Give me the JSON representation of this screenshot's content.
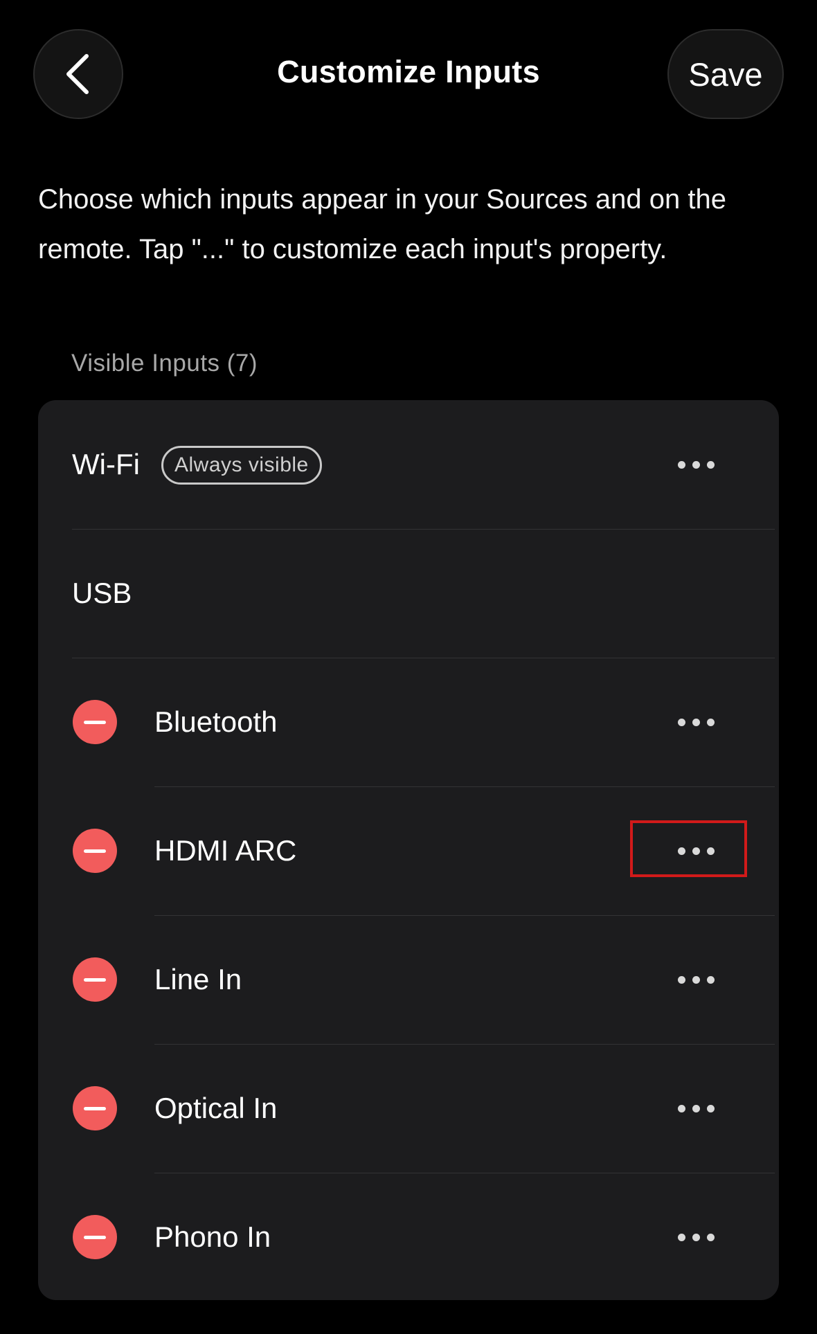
{
  "header": {
    "title": "Customize Inputs",
    "save_label": "Save",
    "back_icon": "chevron-left-icon"
  },
  "description": "Choose which inputs appear in your Sources and on the remote. Tap \"...\" to customize each input's property.",
  "section": {
    "label": "Visible Inputs (7)"
  },
  "inputs": [
    {
      "label": "Wi-Fi",
      "badge": "Always visible",
      "removable": false,
      "has_more": true
    },
    {
      "label": "USB",
      "removable": false,
      "has_more": false
    },
    {
      "label": "Bluetooth",
      "removable": true,
      "has_more": true
    },
    {
      "label": "HDMI ARC",
      "removable": true,
      "has_more": true
    },
    {
      "label": "Line In",
      "removable": true,
      "has_more": true
    },
    {
      "label": "Optical In",
      "removable": true,
      "has_more": true
    },
    {
      "label": "Phono In",
      "removable": true,
      "has_more": true
    }
  ],
  "colors": {
    "background": "#000000",
    "card": "#1c1c1e",
    "remove": "#f25c5c",
    "highlight": "#d11a1a"
  }
}
